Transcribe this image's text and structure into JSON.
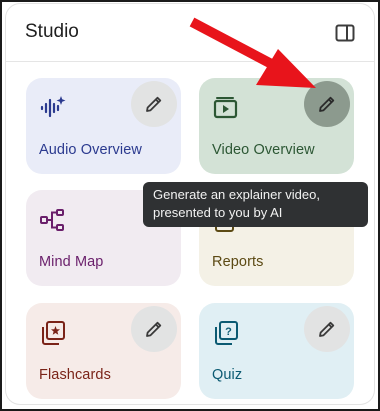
{
  "header": {
    "title": "Studio",
    "toggle_icon": "panel-toggle-icon"
  },
  "cards": [
    {
      "id": "audio",
      "label": "Audio Overview",
      "icon": "audio-waveform-icon",
      "color": "#2b3a8f"
    },
    {
      "id": "video",
      "label": "Video Overview",
      "icon": "video-icon",
      "color": "#2c5734"
    },
    {
      "id": "mind",
      "label": "Mind Map",
      "icon": "mind-map-icon",
      "color": "#6a1f6b"
    },
    {
      "id": "reports",
      "label": "Reports",
      "icon": "reports-icon",
      "color": "#5c4a14"
    },
    {
      "id": "flash",
      "label": "Flashcards",
      "icon": "flashcards-icon",
      "color": "#7a2318"
    },
    {
      "id": "quiz",
      "label": "Quiz",
      "icon": "quiz-icon",
      "color": "#0b5a72"
    }
  ],
  "tooltip": {
    "line1": "Generate an explainer video,",
    "line2": "presented to you by AI"
  },
  "annotation": {
    "arrow_color": "#e8141b"
  }
}
